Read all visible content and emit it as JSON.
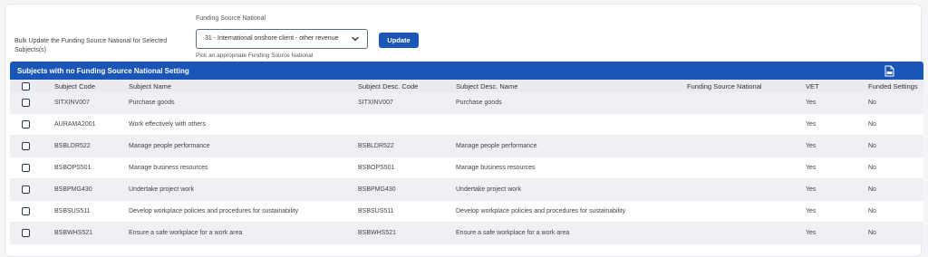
{
  "bulk": {
    "label": "Bulk Update the Funding Source National for Selected Subjects(s)",
    "field_label": "Funding Source National",
    "selected_value": "31 - International onshore client - other revenue",
    "helper": "Pick an appropriate Funding Source National",
    "update_label": "Update"
  },
  "section": {
    "title": "Subjects with no Funding Source National Setting"
  },
  "table": {
    "headers": {
      "code": "Subject Code",
      "name": "Subject Name",
      "desc_code": "Subject Desc. Code",
      "desc_name": "Subject Desc. Name",
      "fsn": "Funding Source National",
      "vet": "VET",
      "funded": "Funded Settings"
    },
    "rows": [
      {
        "code": "SITXINV007",
        "name": "Purchase goods",
        "desc_code": "SITXINV007",
        "desc_name": "Purchase goods",
        "fsn": "",
        "vet": "Yes",
        "funded": "No"
      },
      {
        "code": "AURAMA2001",
        "name": "Work effectively with others",
        "desc_code": "",
        "desc_name": "",
        "fsn": "",
        "vet": "Yes",
        "funded": "No"
      },
      {
        "code": "BSBLDR522",
        "name": "Manage people performance",
        "desc_code": "BSBLDR522",
        "desc_name": "Manage people performance",
        "fsn": "",
        "vet": "Yes",
        "funded": "No"
      },
      {
        "code": "BSBOPS501",
        "name": "Manage business resources",
        "desc_code": "BSBOPS501",
        "desc_name": "Manage business resources",
        "fsn": "",
        "vet": "Yes",
        "funded": "No"
      },
      {
        "code": "BSBPMG430",
        "name": "Undertake project work",
        "desc_code": "BSBPMG430",
        "desc_name": "Undertake project work",
        "fsn": "",
        "vet": "Yes",
        "funded": "No"
      },
      {
        "code": "BSBSUS511",
        "name": "Develop workplace policies and procedures for sustainability",
        "desc_code": "BSBSUS511",
        "desc_name": "Develop workplace policies and procedures for sustainability",
        "fsn": "",
        "vet": "Yes",
        "funded": "No"
      },
      {
        "code": "BSBWHS521",
        "name": "Ensure a safe workplace for a work area",
        "desc_code": "BSBWHS521",
        "desc_name": "Ensure a safe workplace for a work area",
        "fsn": "",
        "vet": "Yes",
        "funded": "No"
      }
    ]
  },
  "icons": {
    "select_chevron": "chevron-down-icon",
    "export": "file-export-icon",
    "checkbox": "checkbox-icon"
  },
  "colors": {
    "accent": "#1a56b8",
    "link": "#1a48a8",
    "header_bg": "#e9ebef",
    "alt_row_bg": "#eef0f3"
  }
}
